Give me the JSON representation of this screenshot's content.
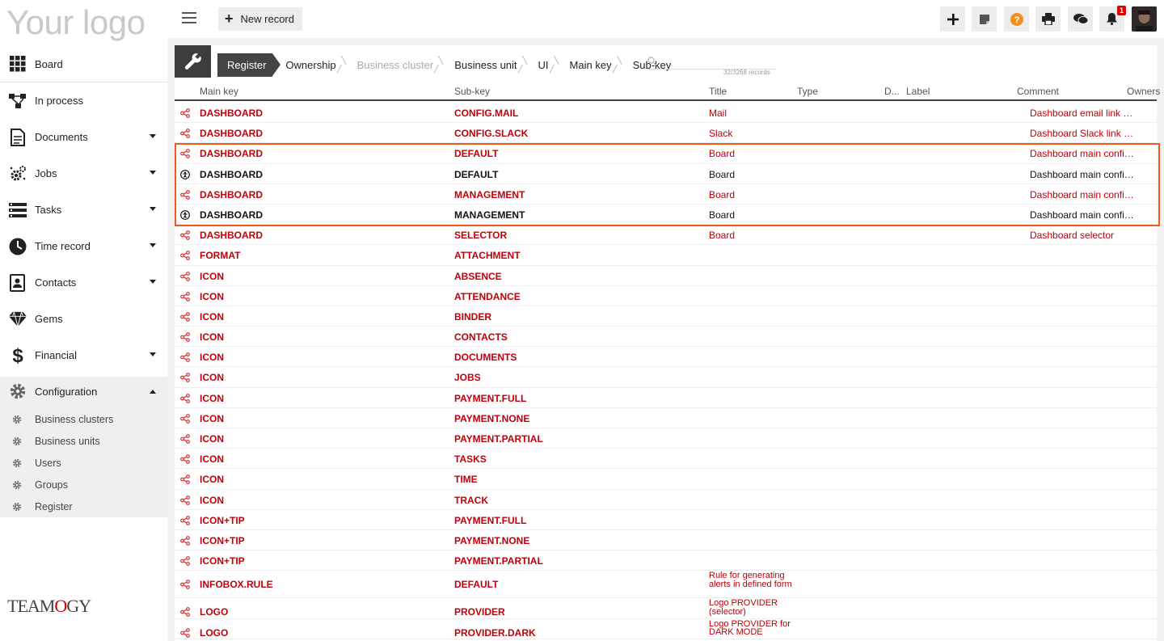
{
  "sidebar": {
    "logo": "Your logo",
    "items": [
      {
        "label": "Board",
        "icon": "grid-icon",
        "caret": false
      },
      {
        "label": "In process",
        "icon": "flow-icon",
        "caret": false
      },
      {
        "label": "Documents",
        "icon": "document-icon",
        "caret": true
      },
      {
        "label": "Jobs",
        "icon": "gears-icon",
        "caret": true
      },
      {
        "label": "Tasks",
        "icon": "tasks-icon",
        "caret": true
      },
      {
        "label": "Time record",
        "icon": "clock-icon",
        "caret": true
      },
      {
        "label": "Contacts",
        "icon": "contacts-icon",
        "caret": true
      },
      {
        "label": "Gems",
        "icon": "diamond-icon",
        "caret": false
      },
      {
        "label": "Financial",
        "icon": "dollar-icon",
        "caret": true
      }
    ],
    "config": {
      "label": "Configuration",
      "children": [
        "Business clusters",
        "Business units",
        "Users",
        "Groups",
        "Register"
      ]
    },
    "brand": {
      "pre": "TEAM",
      "o": "O",
      "post": "GY"
    }
  },
  "topbar": {
    "new_record": "New record",
    "notifications_count": "1"
  },
  "breadcrumbs": [
    {
      "label": "Register",
      "state": "active"
    },
    {
      "label": "Ownership",
      "state": "normal"
    },
    {
      "label": "Business cluster",
      "state": "dim"
    },
    {
      "label": "Business unit",
      "state": "normal"
    },
    {
      "label": "UI",
      "state": "normal"
    },
    {
      "label": "Main key",
      "state": "normal"
    },
    {
      "label": "Sub-key",
      "state": "normal"
    }
  ],
  "search": {
    "placeholder": "",
    "record_count": "32/3268 records"
  },
  "table": {
    "columns": [
      "Main key",
      "Sub-key",
      "Title",
      "Type",
      "D...",
      "Label",
      "Comment",
      "Owners"
    ],
    "rows": [
      {
        "icon": "share",
        "color": "red",
        "main": "DASHBOARD",
        "sub": "CONFIG.MAIL",
        "title": "Mail",
        "comment": "Dashboard email link c..."
      },
      {
        "icon": "share",
        "color": "red",
        "main": "DASHBOARD",
        "sub": "CONFIG.SLACK",
        "title": "Slack",
        "comment": "Dashboard Slack link c..."
      },
      {
        "icon": "share",
        "color": "red",
        "main": "DASHBOARD",
        "sub": "DEFAULT",
        "title": "Board",
        "comment": "Dashboard main config..."
      },
      {
        "icon": "owner",
        "color": "black",
        "main": "DASHBOARD",
        "sub": "DEFAULT",
        "title": "Board",
        "comment": "Dashboard main config..."
      },
      {
        "icon": "share",
        "color": "red",
        "main": "DASHBOARD",
        "sub": "MANAGEMENT",
        "title": "Board",
        "comment": "Dashboard main config..."
      },
      {
        "icon": "owner",
        "color": "black",
        "main": "DASHBOARD",
        "sub": "MANAGEMENT",
        "title": "Board",
        "comment": "Dashboard main config..."
      },
      {
        "icon": "share",
        "color": "red",
        "main": "DASHBOARD",
        "sub": "SELECTOR",
        "title": "Board",
        "comment": "Dashboard selector"
      },
      {
        "icon": "share",
        "color": "red",
        "main": "FORMAT",
        "sub": "ATTACHMENT",
        "title": "",
        "comment": ""
      },
      {
        "icon": "share",
        "color": "red",
        "main": "ICON",
        "sub": "ABSENCE",
        "title": "",
        "comment": ""
      },
      {
        "icon": "share",
        "color": "red",
        "main": "ICON",
        "sub": "ATTENDANCE",
        "title": "",
        "comment": ""
      },
      {
        "icon": "share",
        "color": "red",
        "main": "ICON",
        "sub": "BINDER",
        "title": "",
        "comment": ""
      },
      {
        "icon": "share",
        "color": "red",
        "main": "ICON",
        "sub": "CONTACTS",
        "title": "",
        "comment": ""
      },
      {
        "icon": "share",
        "color": "red",
        "main": "ICON",
        "sub": "DOCUMENTS",
        "title": "",
        "comment": ""
      },
      {
        "icon": "share",
        "color": "red",
        "main": "ICON",
        "sub": "JOBS",
        "title": "",
        "comment": ""
      },
      {
        "icon": "share",
        "color": "red",
        "main": "ICON",
        "sub": "PAYMENT.FULL",
        "title": "",
        "comment": ""
      },
      {
        "icon": "share",
        "color": "red",
        "main": "ICON",
        "sub": "PAYMENT.NONE",
        "title": "",
        "comment": ""
      },
      {
        "icon": "share",
        "color": "red",
        "main": "ICON",
        "sub": "PAYMENT.PARTIAL",
        "title": "",
        "comment": ""
      },
      {
        "icon": "share",
        "color": "red",
        "main": "ICON",
        "sub": "TASKS",
        "title": "",
        "comment": ""
      },
      {
        "icon": "share",
        "color": "red",
        "main": "ICON",
        "sub": "TIME",
        "title": "",
        "comment": ""
      },
      {
        "icon": "share",
        "color": "red",
        "main": "ICON",
        "sub": "TRACK",
        "title": "",
        "comment": ""
      },
      {
        "icon": "share",
        "color": "red",
        "main": "ICON+TIP",
        "sub": "PAYMENT.FULL",
        "title": "",
        "comment": ""
      },
      {
        "icon": "share",
        "color": "red",
        "main": "ICON+TIP",
        "sub": "PAYMENT.NONE",
        "title": "",
        "comment": ""
      },
      {
        "icon": "share",
        "color": "red",
        "main": "ICON+TIP",
        "sub": "PAYMENT.PARTIAL",
        "title": "",
        "comment": ""
      },
      {
        "icon": "share",
        "color": "red",
        "main": "INFOBOX.RULE",
        "sub": "DEFAULT",
        "title": "Rule for generating alerts in defined form",
        "comment": "",
        "tall": true
      },
      {
        "icon": "share",
        "color": "red",
        "main": "LOGO",
        "sub": "PROVIDER",
        "title": "Logo PROVIDER (selector)",
        "comment": "",
        "multi": true
      },
      {
        "icon": "share",
        "color": "red",
        "main": "LOGO",
        "sub": "PROVIDER.DARK",
        "title": "Logo PROVIDER for DARK MODE",
        "comment": "",
        "multi": true
      }
    ]
  },
  "colors": {
    "accent_red": "#c0000a",
    "highlight": "#f05a22",
    "help_orange": "#f0901e",
    "dark_header": "#444444"
  }
}
